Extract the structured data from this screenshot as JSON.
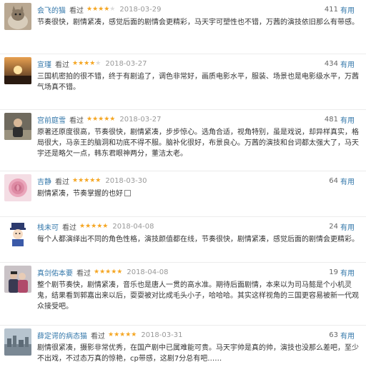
{
  "reviews": [
    {
      "user": "会飞的猫",
      "watched": "看过",
      "rating": 4,
      "date": "2018-03-29",
      "votes": "411",
      "vote_label": "有用",
      "content": "节奏很快，剧情紧凑，感觉后面的剧情会更精彩，马天宇可塑性也不错，万茜的演技依旧那么有带感。",
      "avatar": "cat-avatar"
    },
    {
      "user": "宣瑾",
      "watched": "看过",
      "rating": 4,
      "date": "2018-03-27",
      "votes": "434",
      "vote_label": "有用",
      "content": "三国机密拍的很不错，终于有剧追了，调色非常好，画质电影水平，服装、场景也是电影级水平，万茜气场真不错。",
      "avatar": "sunset-avatar"
    },
    {
      "user": "宫前庭雪",
      "watched": "看过",
      "rating": 5,
      "date": "2018-03-27",
      "votes": "481",
      "vote_label": "有用",
      "content": "原著还原度很高，节奏很快，剧情紧凑，步步惊心。选角合适，视角特别，虽是戏说，却异样真实，格局很大，马亲王的脑洞和功底不得不服。脑补化很好，布景良心。万茜的演技和台词都太强大了，马天宇还是略欠一点，韩东君眼神两分，董洁太老。",
      "avatar": "person-avatar"
    },
    {
      "user": "吉静",
      "watched": "看过",
      "rating": 5,
      "date": "2018-03-30",
      "votes": "64",
      "vote_label": "有用",
      "content": "剧情紧凑，节奏掌握的也好",
      "avatar": "rose-avatar"
    },
    {
      "user": "栈未可",
      "watched": "看过",
      "rating": 5,
      "date": "2018-04-08",
      "votes": "24",
      "vote_label": "有用",
      "content": "每个人都演绎出不同的角色性格，演技颜值都在线，节奏很快，剧情紧凑，感觉后面的剧情会更精彩。",
      "avatar": "cartoon-avatar"
    },
    {
      "user": "真剑佑本要",
      "watched": "看过",
      "rating": 5,
      "date": "2018-04-08",
      "votes": "19",
      "vote_label": "有用",
      "content": "整个剧节奏快，剧情紧凑，音乐也是唐人一贯的高水准。期待后面剧情，本来以为司马懿是个小机灵鬼，结果看到郭嘉出来以后，耍耍被对比成毛头小子，哈哈哈。其实这样视角的三国更容易被新一代观众接受吧。",
      "avatar": "couple-avatar"
    },
    {
      "user": "薛定谔的病态猫",
      "watched": "看过",
      "rating": 5,
      "date": "2018-03-31",
      "votes": "63",
      "vote_label": "有用",
      "content": "剧情很紧凑，摄影非常优秀，在国产剧中已属难能可贵。马天宇帅是真的帅，演技也没那么差吧，至少不出戏，不过态万真的惊艳，cp带感，这剧7分总有吧……",
      "avatar": "city-avatar"
    }
  ]
}
